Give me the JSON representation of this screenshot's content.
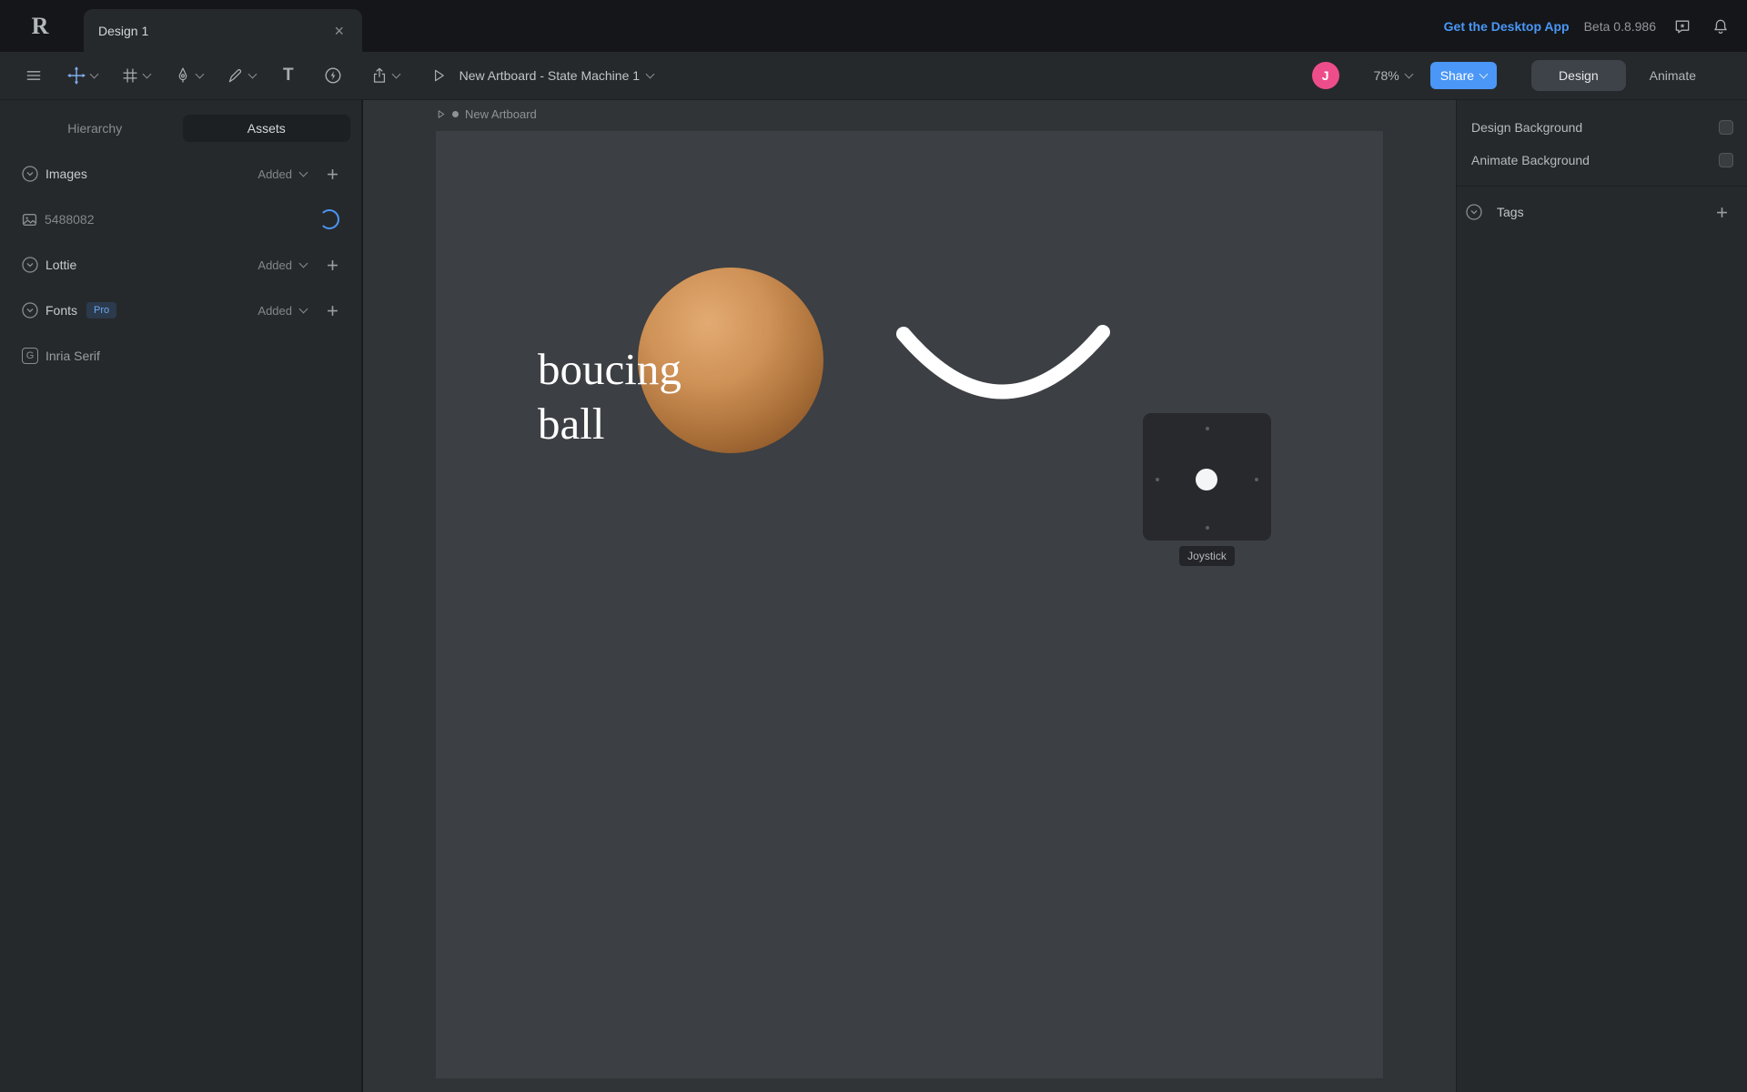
{
  "tabbar": {
    "logo_letter": "R",
    "tab_title": "Design 1",
    "close_icon": "×",
    "desktop_app_link": "Get the Desktop App",
    "version": "Beta 0.8.986"
  },
  "toolbar": {
    "playback_target": "New Artboard - State Machine 1",
    "text_tool_glyph": "T",
    "zoom_level": "78%",
    "share_label": "Share",
    "mode_design": "Design",
    "mode_animate": "Animate",
    "avatar_initial": "J"
  },
  "assets_panel": {
    "tab_hierarchy": "Hierarchy",
    "tab_assets": "Assets",
    "sections": {
      "images": {
        "label": "Images",
        "status": "Added"
      },
      "lottie": {
        "label": "Lottie",
        "status": "Added"
      },
      "fonts": {
        "label": "Fonts",
        "status": "Added",
        "badge": "Pro"
      }
    },
    "image_item": "5488082",
    "font_item": "Inria Serif",
    "font_icon_letter": "G"
  },
  "canvas": {
    "artboard_label": "New Artboard",
    "ball_text_line1": "boucing",
    "ball_text_line2": "ball",
    "joystick_label": "Joystick"
  },
  "inspector": {
    "design_background": "Design Background",
    "animate_background": "Animate Background",
    "tags_label": "Tags"
  },
  "colors": {
    "accent": "#4a97f7",
    "avatar_pink": "#ee4d8b",
    "ball_highlight": "#e2aa72",
    "ball_shadow": "#7d4b20"
  }
}
